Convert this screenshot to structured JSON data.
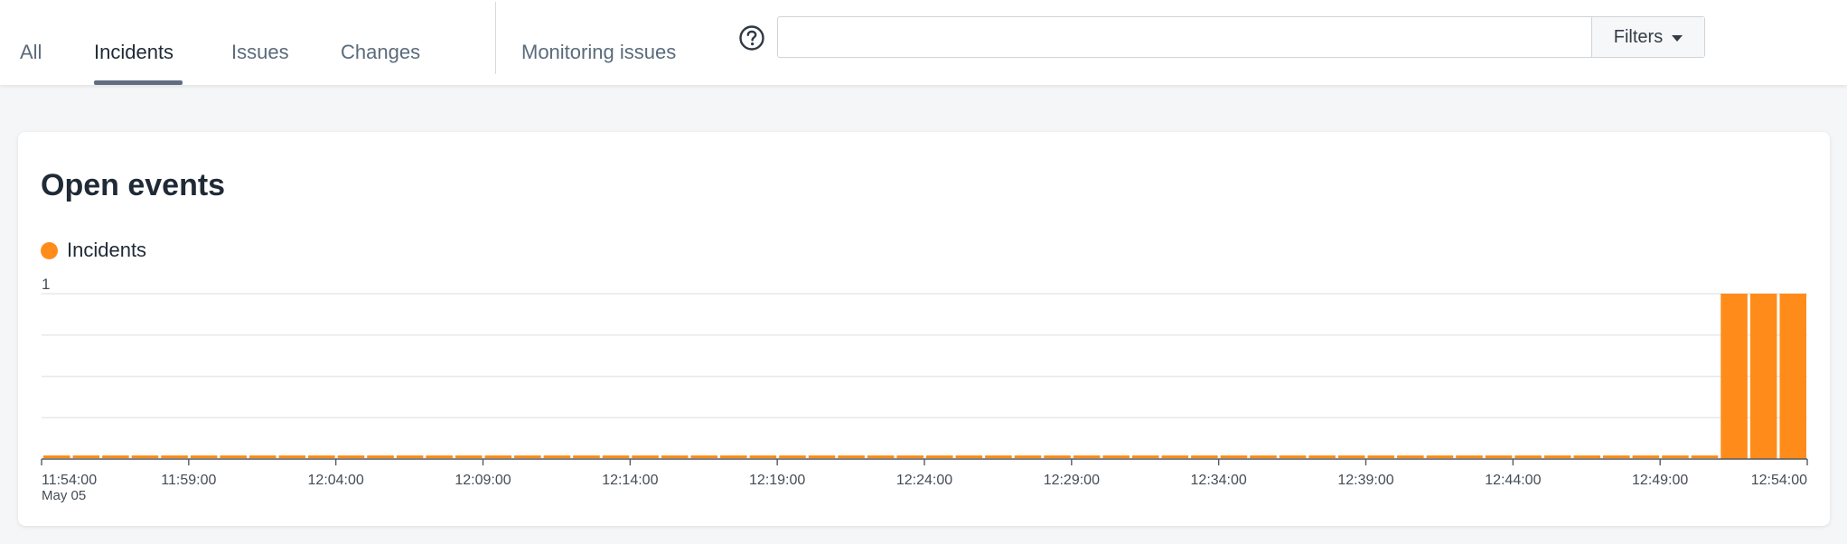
{
  "nav": {
    "tabs": [
      {
        "label": "All",
        "active": false
      },
      {
        "label": "Incidents",
        "active": true
      },
      {
        "label": "Issues",
        "active": false
      },
      {
        "label": "Changes",
        "active": false
      }
    ],
    "monitoring_label": "Monitoring issues",
    "help_icon": "question-circle-icon"
  },
  "search": {
    "value": "",
    "filters_label": "Filters",
    "filters_icon": "caret-down-icon"
  },
  "card": {
    "title": "Open events",
    "legend": [
      {
        "label": "Incidents",
        "color": "#ff8c1a"
      }
    ]
  },
  "chart_data": {
    "type": "bar",
    "title": "Open events",
    "xlabel": "",
    "ylabel": "",
    "ylim": [
      0,
      1
    ],
    "y_tick_labels": [
      "1"
    ],
    "grid": true,
    "legend_position": "top-left",
    "x_tick_labels": [
      "11:54:00",
      "11:59:00",
      "12:04:00",
      "12:09:00",
      "12:14:00",
      "12:19:00",
      "12:24:00",
      "12:29:00",
      "12:34:00",
      "12:39:00",
      "12:44:00",
      "12:49:00",
      "12:54:00"
    ],
    "x_date_label": "May 05",
    "x_range": [
      "11:54:00",
      "12:54:00"
    ],
    "series": [
      {
        "name": "Incidents",
        "color": "#ff8c1a",
        "times": [
          "11:54:00",
          "11:55:00",
          "11:56:00",
          "11:57:00",
          "11:58:00",
          "11:59:00",
          "12:00:00",
          "12:01:00",
          "12:02:00",
          "12:03:00",
          "12:04:00",
          "12:05:00",
          "12:06:00",
          "12:07:00",
          "12:08:00",
          "12:09:00",
          "12:10:00",
          "12:11:00",
          "12:12:00",
          "12:13:00",
          "12:14:00",
          "12:15:00",
          "12:16:00",
          "12:17:00",
          "12:18:00",
          "12:19:00",
          "12:20:00",
          "12:21:00",
          "12:22:00",
          "12:23:00",
          "12:24:00",
          "12:25:00",
          "12:26:00",
          "12:27:00",
          "12:28:00",
          "12:29:00",
          "12:30:00",
          "12:31:00",
          "12:32:00",
          "12:33:00",
          "12:34:00",
          "12:35:00",
          "12:36:00",
          "12:37:00",
          "12:38:00",
          "12:39:00",
          "12:40:00",
          "12:41:00",
          "12:42:00",
          "12:43:00",
          "12:44:00",
          "12:45:00",
          "12:46:00",
          "12:47:00",
          "12:48:00",
          "12:49:00",
          "12:50:00",
          "12:51:00",
          "12:52:00",
          "12:53:00"
        ],
        "values": [
          0,
          0,
          0,
          0,
          0,
          0,
          0,
          0,
          0,
          0,
          0,
          0,
          0,
          0,
          0,
          0,
          0,
          0,
          0,
          0,
          0,
          0,
          0,
          0,
          0,
          0,
          0,
          0,
          0,
          0,
          0,
          0,
          0,
          0,
          0,
          0,
          0,
          0,
          0,
          0,
          0,
          0,
          0,
          0,
          0,
          0,
          0,
          0,
          0,
          0,
          0,
          0,
          0,
          0,
          0,
          0,
          0,
          1,
          1,
          1
        ]
      }
    ]
  }
}
